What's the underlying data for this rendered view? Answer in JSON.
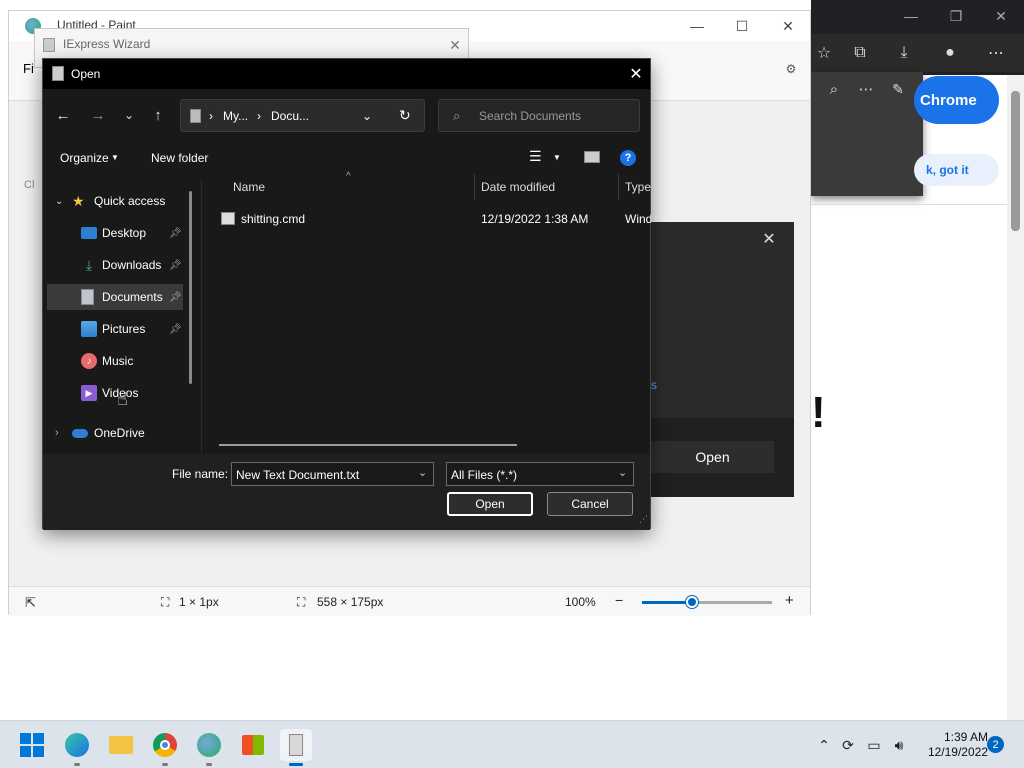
{
  "colors": {
    "accent": "#0067c0",
    "chrome_blue": "#1a73e8",
    "dark_dialog": "#191919"
  },
  "paint": {
    "title": "Untitled - Paint",
    "menu_file": "Fi",
    "side_letter": "Cl",
    "status": {
      "selection": "1 × 1px",
      "canvas_size": "558 × 175px",
      "zoom": "100%"
    }
  },
  "iexpress": {
    "title": "IExpress Wizard"
  },
  "chrome": {
    "button": "Chrome",
    "gotit": "k, got it"
  },
  "bg_dialog": {
    "open_label": "Open",
    "link_text": "s",
    "exclaim": "!"
  },
  "open_dialog": {
    "title": "Open",
    "address": {
      "seg1": "My...",
      "seg2": "Docu..."
    },
    "search_placeholder": "Search Documents",
    "toolbar": {
      "organize": "Organize",
      "new_folder": "New folder"
    },
    "nav": {
      "quick_access": "Quick access",
      "items": [
        {
          "label": "Desktop",
          "icon": "desktop-icon",
          "pinned": true
        },
        {
          "label": "Downloads",
          "icon": "downloads-icon",
          "pinned": true
        },
        {
          "label": "Documents",
          "icon": "documents-icon",
          "pinned": true,
          "selected": true
        },
        {
          "label": "Pictures",
          "icon": "pictures-icon",
          "pinned": true
        },
        {
          "label": "Music",
          "icon": "music-icon",
          "pinned": false
        },
        {
          "label": "Videos",
          "icon": "videos-icon",
          "pinned": false
        }
      ],
      "onedrive": "OneDrive"
    },
    "columns": {
      "name": "Name",
      "date": "Date modified",
      "type": "Type"
    },
    "files": [
      {
        "name": "shitting.cmd",
        "date": "12/19/2022 1:38 AM",
        "type": "Windows Command Script"
      }
    ],
    "file_name_label": "File name:",
    "file_name_value": "New Text Document.txt",
    "file_type_value": "All Files (*.*)",
    "open_button": "Open",
    "cancel_button": "Cancel"
  },
  "taskbar": {
    "time": "1:39 AM",
    "date": "12/19/2022",
    "notifications": "2"
  }
}
